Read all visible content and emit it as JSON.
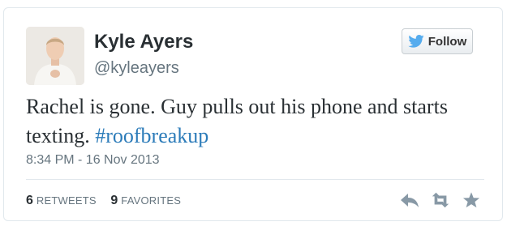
{
  "author": {
    "name": "Kyle Ayers",
    "handle": "@kyleayers"
  },
  "follow_button": {
    "label": "Follow",
    "icon": "twitter-bird-icon"
  },
  "tweet": {
    "text": "Rachel is gone. Guy pulls out his phone and starts texting.",
    "hashtag": "#roofbreakup",
    "timestamp": "8:34 PM - 16 Nov 2013"
  },
  "stats": {
    "retweets_count": "6",
    "retweets_label": "RETWEETS",
    "favorites_count": "9",
    "favorites_label": "FAVORITES"
  },
  "actions": {
    "reply_icon": "reply-icon",
    "retweet_icon": "retweet-icon",
    "favorite_icon": "star-icon"
  },
  "colors": {
    "link": "#2b7bb9",
    "action_icon": "#8899a6"
  }
}
